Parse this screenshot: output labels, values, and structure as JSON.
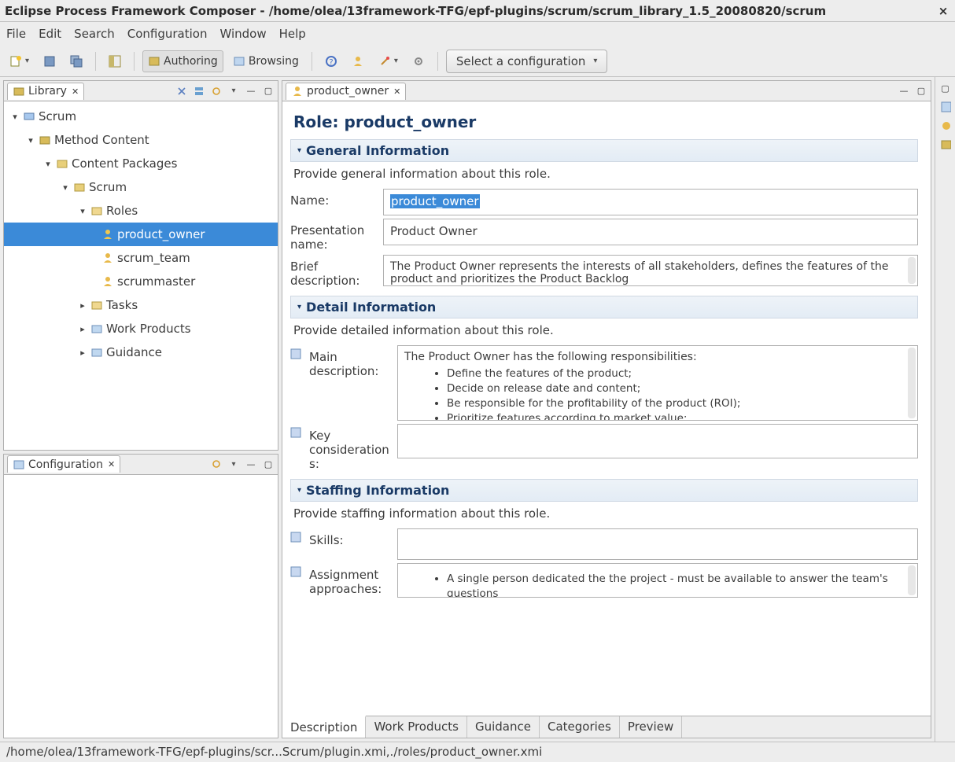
{
  "window": {
    "title": "Eclipse Process Framework Composer - /home/olea/13framework-TFG/epf-plugins/scrum/scrum_library_1.5_20080820/scrum"
  },
  "menu": [
    "File",
    "Edit",
    "Search",
    "Configuration",
    "Window",
    "Help"
  ],
  "toolbar": {
    "authoring": "Authoring",
    "browsing": "Browsing",
    "config_select": "Select a configuration"
  },
  "library": {
    "tab": "Library",
    "tree": {
      "root": "Scrum",
      "method_content": "Method Content",
      "content_packages": "Content Packages",
      "scrum_pkg": "Scrum",
      "roles": "Roles",
      "role_items": [
        "product_owner",
        "scrum_team",
        "scrummaster"
      ],
      "tasks": "Tasks",
      "work_products": "Work Products",
      "guidance": "Guidance"
    }
  },
  "config": {
    "tab": "Configuration"
  },
  "editor": {
    "tab": "product_owner",
    "title": "Role: product_owner",
    "sections": {
      "general": {
        "head": "General Information",
        "desc": "Provide general information about this role.",
        "name_lbl": "Name:",
        "name_val": "product_owner",
        "pres_lbl": "Presentation name:",
        "pres_val": "Product Owner",
        "brief_lbl": "Brief description:",
        "brief_val": "The Product Owner represents the interests of all stakeholders, defines the features of the product and prioritizes the Product Backlog"
      },
      "detail": {
        "head": "Detail Information",
        "desc": "Provide detailed information about this role.",
        "main_lbl": "Main description:",
        "main_intro": "The Product Owner has the following responsibilities:",
        "main_bullets": [
          "Define the features of the product;",
          "Decide on release date and content;",
          "Be responsible for the profitability of the product (ROI);",
          "Prioritize features according to market value;"
        ],
        "key_lbl": "Key considerations:"
      },
      "staffing": {
        "head": "Staffing Information",
        "desc": "Provide staffing information about this role.",
        "skills_lbl": "Skills:",
        "assign_lbl": "Assignment approaches:",
        "assign_bullets": [
          "A single person dedicated the the project - must be available to answer the team's questions"
        ]
      }
    },
    "bottom_tabs": [
      "Description",
      "Work Products",
      "Guidance",
      "Categories",
      "Preview"
    ]
  },
  "status": "/home/olea/13framework-TFG/epf-plugins/scr...Scrum/plugin.xmi,./roles/product_owner.xmi"
}
